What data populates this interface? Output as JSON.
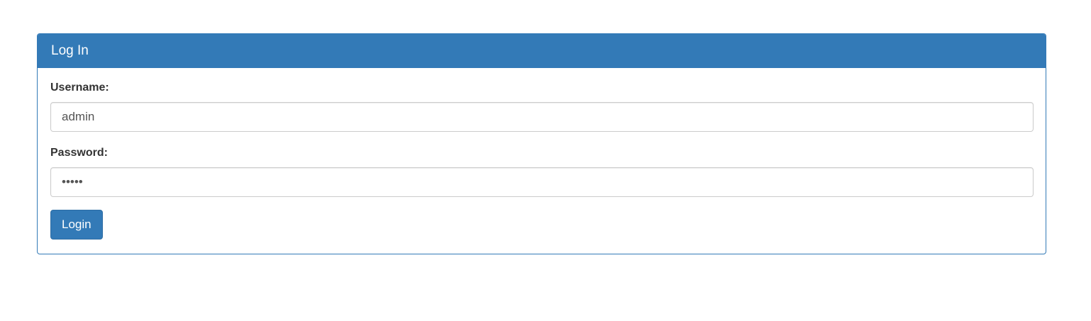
{
  "panel": {
    "title": "Log In"
  },
  "form": {
    "username": {
      "label": "Username:",
      "value": "admin"
    },
    "password": {
      "label": "Password:",
      "value": "•••••"
    },
    "submit_label": "Login"
  },
  "colors": {
    "primary": "#337ab7",
    "border": "#cccccc",
    "text": "#333333"
  }
}
